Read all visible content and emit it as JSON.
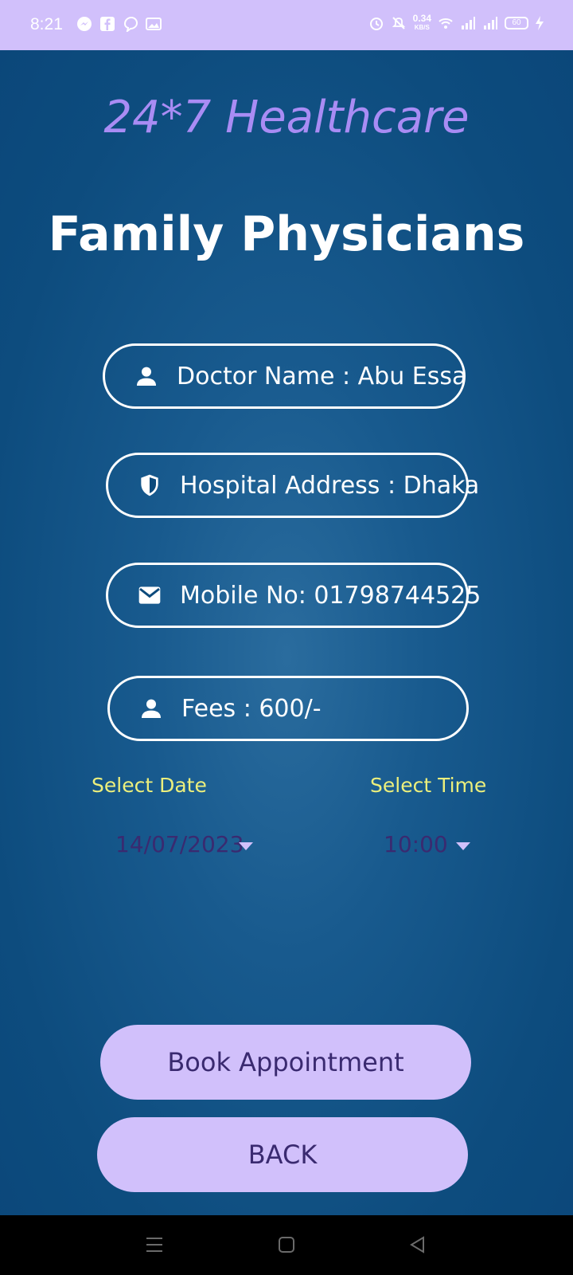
{
  "status_bar": {
    "time": "8:21",
    "net_speed_value": "0.34",
    "net_speed_unit": "KB/S",
    "battery": "60",
    "left_icons": [
      "messenger-icon",
      "facebook-icon",
      "hangouts-icon",
      "gallery-icon"
    ],
    "right_icons": [
      "alarm-icon",
      "mute-icon",
      "wifi-icon",
      "signal-icon",
      "signal-icon",
      "battery-icon",
      "charging-icon"
    ]
  },
  "app": {
    "title": "24*7 Healthcare",
    "page_title": "Family Physicians"
  },
  "fields": {
    "doctor": {
      "text": "Doctor Name : Abu Essa",
      "icon": "person-icon"
    },
    "hospital": {
      "text": "Hospital Address : Dhaka",
      "icon": "shield-icon"
    },
    "mobile": {
      "text": "Mobile No: 01798744525",
      "icon": "mail-icon"
    },
    "fees": {
      "text": "Fees : 600/-",
      "icon": "person-icon"
    }
  },
  "schedule": {
    "date_label": "Select Date",
    "time_label": "Select Time",
    "date_value": "14/07/2023",
    "time_value": "10:00"
  },
  "buttons": {
    "book": "Book Appointment",
    "back": "BACK"
  },
  "colors": {
    "status_bar": "#d1c0fb",
    "background": "#0c4a7c",
    "title_purple": "#a98cf4",
    "label_yellow": "#ecef7c",
    "button_fill": "#d1c0fb",
    "button_text": "#3a2a70"
  }
}
